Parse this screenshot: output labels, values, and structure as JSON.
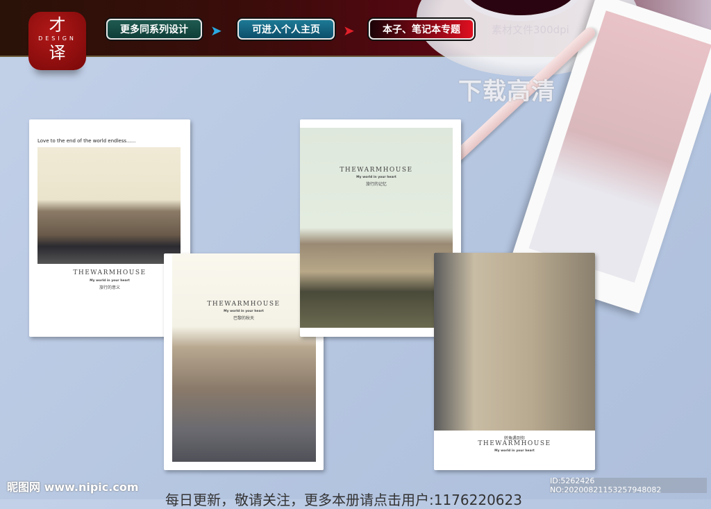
{
  "header": {
    "logo_top": "才",
    "logo_mid": "DESIGN",
    "logo_bottom": "译",
    "buttons": [
      "更多同系列设计",
      "可进入个人主页",
      "本子、笔记本专题"
    ],
    "spec": "素材文件300dpi",
    "watermark": "下载高清"
  },
  "notebooks": [
    {
      "tagline": "Love to the end of the world endless......",
      "brand": "THEWARMHOUSE",
      "subtitle": "My world in your heart",
      "cn": "旅行的意义"
    },
    {
      "brand": "THEWARMHOUSE",
      "subtitle": "My world in your heart",
      "cn": "旅行的记忆"
    },
    {
      "brand": "THEWARMHOUSE",
      "subtitle": "My world in your heart",
      "cn": "巴黎的秋天"
    },
    {
      "brand": "THEWARMHOUSE",
      "subtitle": "My world in your heart",
      "cn": "转角遇到你"
    }
  ],
  "footer": {
    "site": "昵图网 www.nipic.com",
    "id": "ID:5262426 NO:20200821153257948082",
    "notice": "每日更新，敬请关注，更多本册请点击用户:1176220623"
  }
}
